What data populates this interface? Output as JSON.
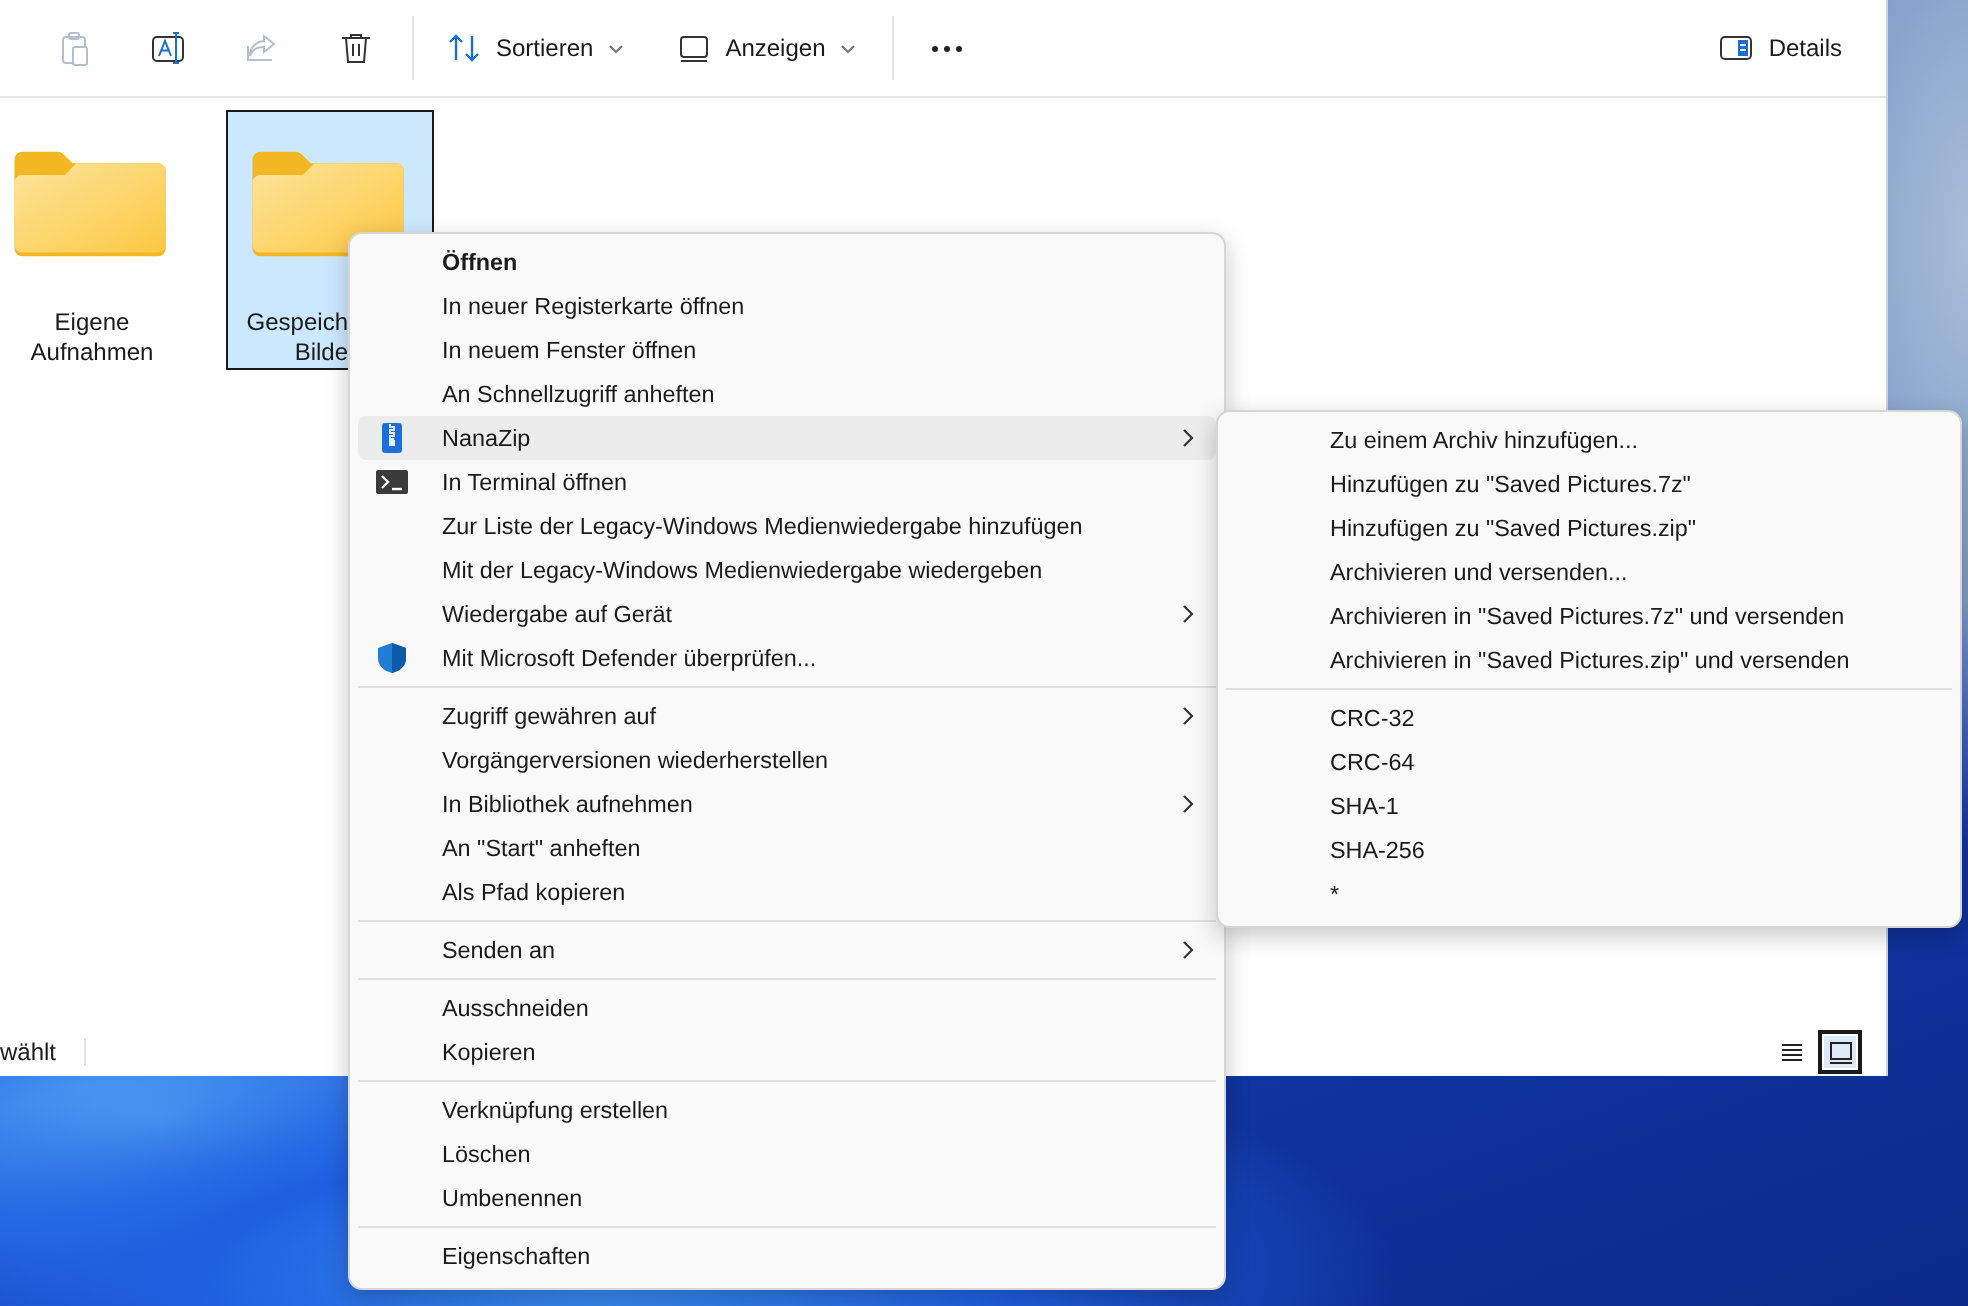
{
  "toolbar": {
    "actions": [
      {
        "kind": "paste",
        "disabled": true
      },
      {
        "kind": "rename",
        "disabled": false
      },
      {
        "kind": "share",
        "disabled": true
      },
      {
        "kind": "delete",
        "disabled": false
      }
    ],
    "sort": {
      "label": "Sortieren"
    },
    "view": {
      "label": "Anzeigen"
    },
    "details": {
      "label": "Details"
    }
  },
  "files": [
    {
      "label_lines": [
        "Eigene",
        "Aufnahmen"
      ],
      "selected": false
    },
    {
      "label_lines": [
        "Gespeich",
        "Bilde"
      ],
      "selected": true
    }
  ],
  "status_bar": {
    "text": "wählt",
    "views": [
      {
        "kind": "details",
        "selected": false
      },
      {
        "kind": "tiles",
        "selected": true
      }
    ]
  },
  "context_menu": {
    "groups": [
      {
        "items": [
          {
            "label": "Öffnen",
            "kind": "plain",
            "default": true,
            "has_submenu": false,
            "highlighted": false
          },
          {
            "label": "In neuer Registerkarte öffnen",
            "kind": "plain",
            "default": false,
            "has_submenu": false,
            "highlighted": false
          },
          {
            "label": "In neuem Fenster öffnen",
            "kind": "plain",
            "default": false,
            "has_submenu": false,
            "highlighted": false
          },
          {
            "label": "An Schnellzugriff anheften",
            "kind": "plain",
            "default": false,
            "has_submenu": false,
            "highlighted": false
          },
          {
            "label": "NanaZip",
            "kind": "zip",
            "default": false,
            "has_submenu": true,
            "highlighted": true
          },
          {
            "label": "In Terminal öffnen",
            "kind": "terminal",
            "default": false,
            "has_submenu": false,
            "highlighted": false
          },
          {
            "label": "Zur Liste der Legacy-Windows Medienwiedergabe hinzufügen",
            "kind": "plain",
            "default": false,
            "has_submenu": false,
            "highlighted": false
          },
          {
            "label": "Mit der Legacy-Windows Medienwiedergabe wiedergeben",
            "kind": "plain",
            "default": false,
            "has_submenu": false,
            "highlighted": false
          },
          {
            "label": "Wiedergabe auf Gerät",
            "kind": "plain",
            "default": false,
            "has_submenu": true,
            "highlighted": false
          },
          {
            "label": "Mit Microsoft Defender überprüfen...",
            "kind": "shield",
            "default": false,
            "has_submenu": false,
            "highlighted": false
          }
        ]
      },
      {
        "items": [
          {
            "label": "Zugriff gewähren auf",
            "kind": "plain",
            "default": false,
            "has_submenu": true,
            "highlighted": false
          },
          {
            "label": "Vorgängerversionen wiederherstellen",
            "kind": "plain",
            "default": false,
            "has_submenu": false,
            "highlighted": false
          },
          {
            "label": "In Bibliothek aufnehmen",
            "kind": "plain",
            "default": false,
            "has_submenu": true,
            "highlighted": false
          },
          {
            "label": "An \"Start\" anheften",
            "kind": "plain",
            "default": false,
            "has_submenu": false,
            "highlighted": false
          },
          {
            "label": "Als Pfad kopieren",
            "kind": "plain",
            "default": false,
            "has_submenu": false,
            "highlighted": false
          }
        ]
      },
      {
        "items": [
          {
            "label": "Senden an",
            "kind": "plain",
            "default": false,
            "has_submenu": true,
            "highlighted": false
          }
        ]
      },
      {
        "items": [
          {
            "label": "Ausschneiden",
            "kind": "plain",
            "default": false,
            "has_submenu": false,
            "highlighted": false
          },
          {
            "label": "Kopieren",
            "kind": "plain",
            "default": false,
            "has_submenu": false,
            "highlighted": false
          }
        ]
      },
      {
        "items": [
          {
            "label": "Verknüpfung erstellen",
            "kind": "plain",
            "default": false,
            "has_submenu": false,
            "highlighted": false
          },
          {
            "label": "Löschen",
            "kind": "plain",
            "default": false,
            "has_submenu": false,
            "highlighted": false
          },
          {
            "label": "Umbenennen",
            "kind": "plain",
            "default": false,
            "has_submenu": false,
            "highlighted": false
          }
        ]
      },
      {
        "items": [
          {
            "label": "Eigenschaften",
            "kind": "plain",
            "default": false,
            "has_submenu": false,
            "highlighted": false
          }
        ]
      }
    ]
  },
  "submenu": {
    "groups": [
      {
        "items": [
          "Zu einem Archiv hinzufügen...",
          "Hinzufügen zu \"Saved Pictures.7z\"",
          "Hinzufügen zu \"Saved Pictures.zip\"",
          "Archivieren und versenden...",
          "Archivieren in \"Saved Pictures.7z\" und versenden",
          "Archivieren in \"Saved Pictures.zip\" und versenden"
        ]
      },
      {
        "items": [
          "CRC-32",
          "CRC-64",
          "SHA-1",
          "SHA-256",
          "*"
        ]
      }
    ]
  }
}
